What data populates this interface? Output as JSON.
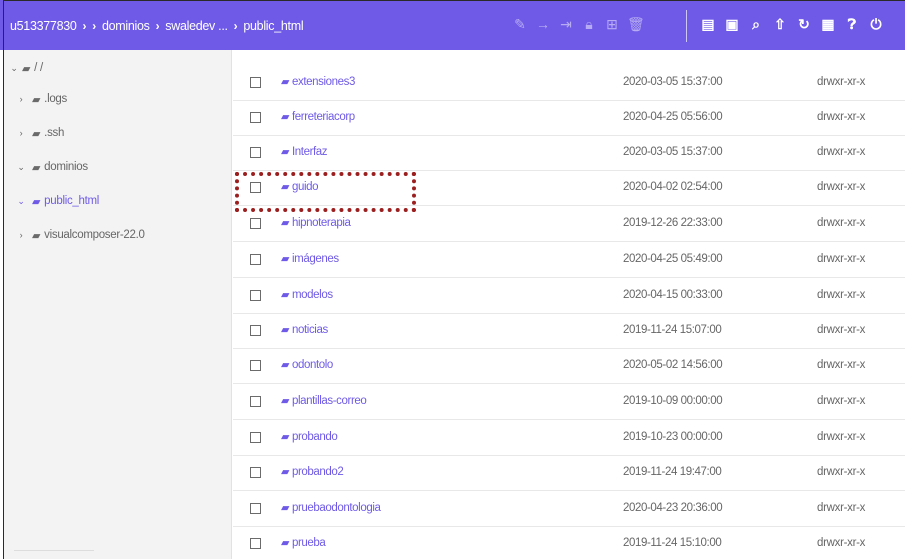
{
  "header": {
    "breadcrumbs": [
      "u513377830",
      "dominios",
      "swaledev ...",
      "public_html"
    ],
    "separator": "›",
    "toolbar_disabled_icons": [
      "edit-icon",
      "move-icon",
      "export-icon",
      "lock-icon",
      "compress-icon",
      "trash-icon"
    ],
    "toolbar_icons": [
      "new-file-icon",
      "new-folder-icon",
      "search-icon",
      "upload-icon",
      "refresh-icon",
      "grid-view-icon",
      "help-icon",
      "logout-icon"
    ],
    "accent_color": "#6e5ae6"
  },
  "sidebar": {
    "items": [
      {
        "label": "/ /",
        "expanded": true,
        "level": 0,
        "icon": "folder-open-icon"
      },
      {
        "label": ".logs",
        "expanded": false,
        "level": 1,
        "icon": "folder-icon"
      },
      {
        "label": ".ssh",
        "expanded": false,
        "level": 1,
        "icon": "folder-icon"
      },
      {
        "label": "dominios",
        "expanded": true,
        "level": 1,
        "icon": "folder-open-icon"
      },
      {
        "label": "public_html",
        "expanded": true,
        "level": 1,
        "icon": "folder-link-icon",
        "active": true
      },
      {
        "label": "visualcomposer-22.0",
        "expanded": false,
        "level": 1,
        "icon": "folder-icon"
      }
    ]
  },
  "files": [
    {
      "name": "extensiones3",
      "date": "2020-03-05 15:37:00",
      "perms": "drwxr-xr-x"
    },
    {
      "name": "ferreteriacorp",
      "date": "2020-04-25 05:56:00",
      "perms": "drwxr-xr-x"
    },
    {
      "name": "Interfaz",
      "date": "2020-03-05 15:37:00",
      "perms": "drwxr-xr-x"
    },
    {
      "name": "guido",
      "date": "2020-04-02 02:54:00",
      "perms": "drwxr-xr-x"
    },
    {
      "name": "hipnoterapia",
      "date": "2019-12-26 22:33:00",
      "perms": "drwxr-xr-x"
    },
    {
      "name": "imágenes",
      "date": "2020-04-25 05:49:00",
      "perms": "drwxr-xr-x"
    },
    {
      "name": "modelos",
      "date": "2020-04-15 00:33:00",
      "perms": "drwxr-xr-x"
    },
    {
      "name": "noticias",
      "date": "2019-11-24 15:07:00",
      "perms": "drwxr-xr-x"
    },
    {
      "name": "odontolo",
      "date": "2020-05-02 14:56:00",
      "perms": "drwxr-xr-x"
    },
    {
      "name": "plantillas-correo",
      "date": "2019-10-09 00:00:00",
      "perms": "drwxr-xr-x"
    },
    {
      "name": "probando",
      "date": "2019-10-23 00:00:00",
      "perms": "drwxr-xr-x"
    },
    {
      "name": "probando2",
      "date": "2019-11-24 19:47:00",
      "perms": "drwxr-xr-x"
    },
    {
      "name": "pruebaodontologia",
      "date": "2020-04-23 20:36:00",
      "perms": "drwxr-xr-x"
    },
    {
      "name": "prueba",
      "date": "2019-11-24 15:10:00",
      "perms": "drwxr-xr-x"
    }
  ],
  "annotation": {
    "highlighted_item": "guido",
    "color": "#9b1f1f"
  }
}
